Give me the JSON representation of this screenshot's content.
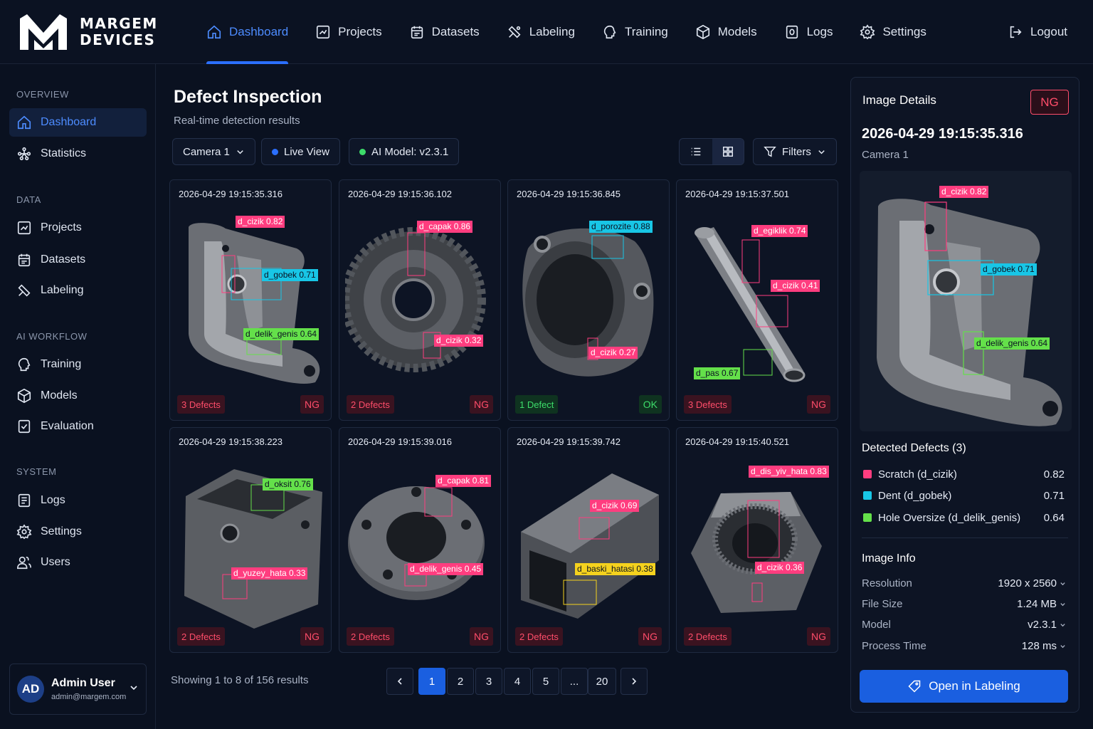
{
  "brand": {
    "line1": "MARGEM",
    "line2": "DEVICES"
  },
  "nav": [
    {
      "label": "Dashboard",
      "icon": "home-icon"
    },
    {
      "label": "Projects",
      "icon": "projects-icon"
    },
    {
      "label": "Datasets",
      "icon": "datasets-icon"
    },
    {
      "label": "Labeling",
      "icon": "labeling-icon"
    },
    {
      "label": "Training",
      "icon": "training-icon"
    },
    {
      "label": "Models",
      "icon": "models-icon"
    },
    {
      "label": "Logs",
      "icon": "logs-icon"
    },
    {
      "label": "Settings",
      "icon": "settings-icon"
    }
  ],
  "logout": "Logout",
  "sidebar": {
    "overview": "OVERVIEW",
    "dashboard": "Dashboard",
    "statistics": "Statistics",
    "data": "DATA",
    "projects": "Projects",
    "datasets": "Datasets",
    "labeling": "Labeling",
    "ai_workflow": "AI WORKFLOW",
    "training": "Training",
    "models": "Models",
    "evaluation": "Evaluation",
    "system": "SYSTEM",
    "logs": "Logs",
    "settings": "Settings",
    "users": "Users"
  },
  "user": {
    "initials": "AD",
    "name": "Admin User",
    "email": "admin@margem.com"
  },
  "main": {
    "title": "Defect Inspection",
    "subtitle": "Real-time detection results",
    "camera": "Camera 1",
    "live": "Live View",
    "model": "AI Model: v2.3.1",
    "filters": "Filters"
  },
  "colors": {
    "accent": "#2b6fff",
    "ng": "#ff4d6a",
    "ok": "#3ddc6a",
    "scratch": "#ff3d7f",
    "dent": "#18c6e6",
    "hole": "#64e04a",
    "print": "#f5d21e"
  },
  "cards": [
    {
      "ts": "2026-04-29 19:15:35.316",
      "defects": "3 Defects",
      "status": "NG",
      "labels": [
        "d_cizik 0.82",
        "d_gobek 0.71",
        "d_delik_genis 0.64"
      ]
    },
    {
      "ts": "2026-04-29 19:15:36.102",
      "defects": "2 Defects",
      "status": "NG",
      "labels": [
        "d_capak 0.86",
        "d_cizik 0.32"
      ]
    },
    {
      "ts": "2026-04-29 19:15:36.845",
      "defects": "1 Defect",
      "status": "OK",
      "labels": [
        "d_porozite 0.88",
        "d_cizik 0.27"
      ]
    },
    {
      "ts": "2026-04-29 19:15:37.501",
      "defects": "3 Defects",
      "status": "NG",
      "labels": [
        "d_egiklik 0.74",
        "d_cizik 0.41",
        "d_pas 0.67"
      ]
    },
    {
      "ts": "2026-04-29 19:15:38.223",
      "defects": "2 Defects",
      "status": "NG",
      "labels": [
        "d_oksit 0.76",
        "d_yuzey_hata 0.33"
      ]
    },
    {
      "ts": "2026-04-29 19:15:39.016",
      "defects": "2 Defects",
      "status": "NG",
      "labels": [
        "d_capak 0.81",
        "d_delik_genis 0.45"
      ]
    },
    {
      "ts": "2026-04-29 19:15:39.742",
      "defects": "2 Defects",
      "status": "NG",
      "labels": [
        "d_cizik 0.69",
        "d_baski_hatasi 0.38"
      ]
    },
    {
      "ts": "2026-04-29 19:15:40.521",
      "defects": "2 Defects",
      "status": "NG",
      "labels": [
        "d_dis_yiv_hata 0.83",
        "d_cizik 0.36"
      ]
    }
  ],
  "pagination": {
    "showing": "Showing 1 to 8 of 156 results",
    "pages": [
      "1",
      "2",
      "3",
      "4",
      "5",
      "...",
      "20"
    ]
  },
  "panel": {
    "title": "Image Details",
    "status": "NG",
    "ts": "2026-04-29 19:15:35.316",
    "camera": "Camera 1",
    "img_labels": [
      "d_cizik 0.82",
      "d_gobek 0.71",
      "d_delik_genis 0.64"
    ],
    "detected_title": "Detected Defects (3)",
    "defects": [
      {
        "name": "Scratch (d_cizik)",
        "score": "0.82"
      },
      {
        "name": "Dent (d_gobek)",
        "score": "0.71"
      },
      {
        "name": "Hole Oversize (d_delik_genis)",
        "score": "0.64"
      }
    ],
    "info_title": "Image Info",
    "info": [
      {
        "k": "Resolution",
        "v": "1920 x 2560"
      },
      {
        "k": "File Size",
        "v": "1.24 MB"
      },
      {
        "k": "Model",
        "v": "v2.3.1"
      },
      {
        "k": "Process Time",
        "v": "128 ms"
      }
    ],
    "open_btn": "Open in Labeling"
  }
}
